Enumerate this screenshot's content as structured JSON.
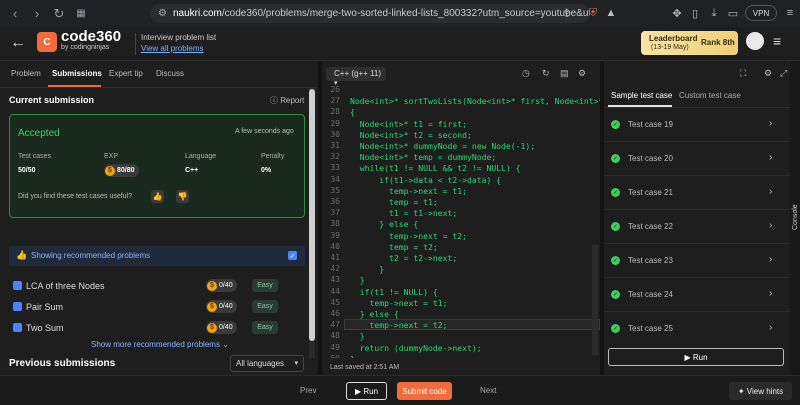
{
  "browser": {
    "url_host": "naukri.com",
    "url_path": "/code360/problems/merge-two-sorted-linked-lists_800332?utm_source=youtube&utm_m...",
    "vpn_label": "VPN"
  },
  "header": {
    "logo_text": "code360",
    "logo_sub": "by codingninjas",
    "problem_list_title": "Interview problem list",
    "problem_list_link": "View all problems",
    "leaderboard_title": "Leaderboard",
    "leaderboard_dates": "(13-19 May)",
    "leaderboard_rank": "Rank 8th"
  },
  "left": {
    "tabs": [
      "Problem",
      "Submissions",
      "Expert tip",
      "Discuss"
    ],
    "current_submission": "Current submission",
    "report": "Report",
    "status": "Accepted",
    "time": "A few seconds ago",
    "stats_headers": [
      "Test cases",
      "EXP",
      "Language",
      "Penalty"
    ],
    "stats_values": [
      "50/50",
      "80/80",
      "C++",
      "0%"
    ],
    "useful_q": "Did you find these test cases useful?",
    "recommended_label": "Showing recommended problems",
    "problems": [
      {
        "name": "LCA of three Nodes",
        "points": "0/40",
        "difficulty": "Easy"
      },
      {
        "name": "Pair Sum",
        "points": "0/40",
        "difficulty": "Easy"
      },
      {
        "name": "Two Sum",
        "points": "0/40",
        "difficulty": "Easy"
      }
    ],
    "show_more": "Show more recommended problems",
    "prev_submissions": "Previous submissions",
    "language_select": "All languages"
  },
  "editor": {
    "language": "C++ (g++ 11)",
    "line_numbers": [
      "26",
      "27",
      "28",
      "29",
      "30",
      "31",
      "32",
      "33",
      "34",
      "35",
      "36",
      "37",
      "38",
      "39",
      "40",
      "41",
      "42",
      "43",
      "44",
      "45",
      "46",
      "47",
      "48",
      "49",
      "50"
    ],
    "code_lines": [
      "",
      "Node<int>* sortTwoLists(Node<int>* first, Node<int>* se",
      "{",
      "  Node<int>* t1 = first;",
      "  Node<int>* t2 = second;",
      "  Node<int>* dummyNode = new Node(-1);",
      "  Node<int>* temp = dummyNode;",
      "  while(t1 != NULL && t2 != NULL) {",
      "      if(t1->data < t2->data) {",
      "        temp->next = t1;",
      "        temp = t1;",
      "        t1 = t1->next;",
      "      } else {",
      "        temp->next = t2;",
      "        temp = t2;",
      "        t2 = t2->next;",
      "      }",
      "  }",
      "  if(t1 != NULL) {",
      "    temp->next = t1;",
      "  } else {",
      "    temp->next = t2;",
      "  }",
      "  return (dummyNode->next);",
      "}"
    ],
    "last_saved": "Last saved at 2:51 AM"
  },
  "right": {
    "tabs": [
      "Sample test case",
      "Custom test case"
    ],
    "test_cases": [
      "Test case 19",
      "Test case 20",
      "Test case 21",
      "Test case 22",
      "Test case 23",
      "Test case 24",
      "Test case 25"
    ],
    "run_label": "Run",
    "console_label": "Console"
  },
  "footer": {
    "prev": "Prev",
    "run": "Run",
    "submit": "Submit code",
    "next": "Next",
    "hints": "View hints"
  },
  "colors": {
    "accent": "#f26b3a",
    "accepted": "#3ecf5a",
    "code": "#2ed573",
    "link": "#8ab4ff"
  }
}
